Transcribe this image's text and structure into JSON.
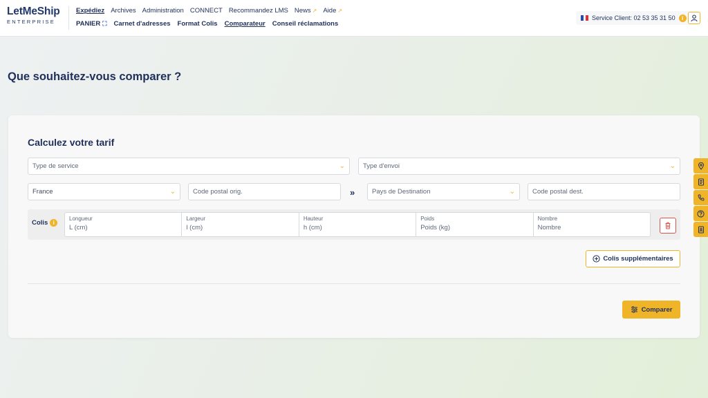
{
  "brand": {
    "name_part1": "LetMeShip",
    "tagline": "ENTERPRISE"
  },
  "nav_primary": [
    {
      "label": "Expédiez",
      "active": true,
      "external": false
    },
    {
      "label": "Archives",
      "active": false,
      "external": false
    },
    {
      "label": "Administration",
      "active": false,
      "external": false
    },
    {
      "label": "CONNECT",
      "active": false,
      "external": false
    },
    {
      "label": "Recommandez LMS",
      "active": false,
      "external": false
    },
    {
      "label": "News",
      "active": false,
      "external": true
    },
    {
      "label": "Aide",
      "active": false,
      "external": true
    }
  ],
  "nav_secondary": [
    {
      "label": "PANIER",
      "active": false
    },
    {
      "label": "Carnet d'adresses",
      "active": false
    },
    {
      "label": "Format Colis",
      "active": false
    },
    {
      "label": "Comparateur",
      "active": true
    },
    {
      "label": "Conseil réclamations",
      "active": false
    }
  ],
  "service_client": {
    "label": "Service Client: 02 53 35 31 50",
    "info_glyph": "i"
  },
  "page": {
    "title": "Que souhaitez-vous comparer ?"
  },
  "form": {
    "title": "Calculez votre tarif",
    "type_service_placeholder": "Type de service",
    "type_envoi_placeholder": "Type d'envoi",
    "origin_country": "France",
    "origin_postal_placeholder": "Code postal orig.",
    "direction_arrows": "»",
    "destination_country_placeholder": "Pays de Destination",
    "destination_postal_placeholder": "Code postal dest.",
    "colis": {
      "label": "Colis",
      "info_glyph": "i",
      "fields": [
        {
          "label": "Longueur",
          "placeholder": "L (cm)"
        },
        {
          "label": "Largeur",
          "placeholder": "l (cm)"
        },
        {
          "label": "Hauteur",
          "placeholder": "h (cm)"
        },
        {
          "label": "Poids",
          "placeholder": "Poids (kg)"
        },
        {
          "label": "Nombre",
          "placeholder": "Nombre"
        }
      ]
    },
    "add_parcel_label": "Colis supplémentaires",
    "compare_label": "Comparer"
  },
  "side_tabs": [
    "location-pin-icon",
    "document-icon",
    "phone-icon",
    "help-icon",
    "contact-book-icon"
  ],
  "colors": {
    "accent": "#f0b429",
    "navy": "#1f2f5a",
    "danger": "#d9534f"
  }
}
